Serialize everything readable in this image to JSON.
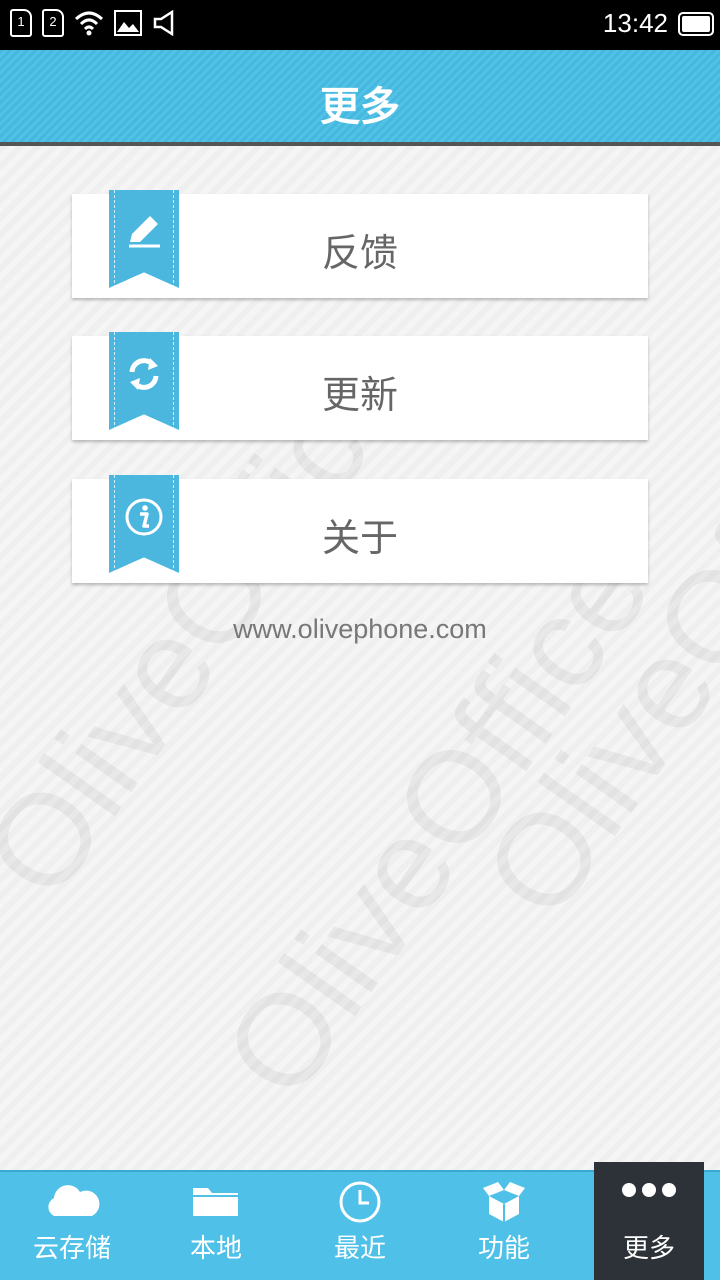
{
  "status_bar": {
    "sim1": "1",
    "sim2": "2",
    "time": "13:42"
  },
  "header": {
    "title": "更多"
  },
  "menu": [
    {
      "label": "反馈",
      "icon": "pencil-icon"
    },
    {
      "label": "更新",
      "icon": "refresh-icon"
    },
    {
      "label": "关于",
      "icon": "info-icon"
    }
  ],
  "website": "www.olivephone.com",
  "watermark_text": "OliveOffice",
  "bottom_nav": [
    {
      "label": "云存储",
      "icon": "cloud-icon"
    },
    {
      "label": "本地",
      "icon": "folder-icon"
    },
    {
      "label": "最近",
      "icon": "clock-icon"
    },
    {
      "label": "功能",
      "icon": "box-icon"
    },
    {
      "label": "更多",
      "icon": "more-dots-icon",
      "active": true
    }
  ],
  "colors": {
    "accent": "#4fc0e8",
    "active_tab": "#2d3238",
    "ribbon": "#4bb7df"
  }
}
